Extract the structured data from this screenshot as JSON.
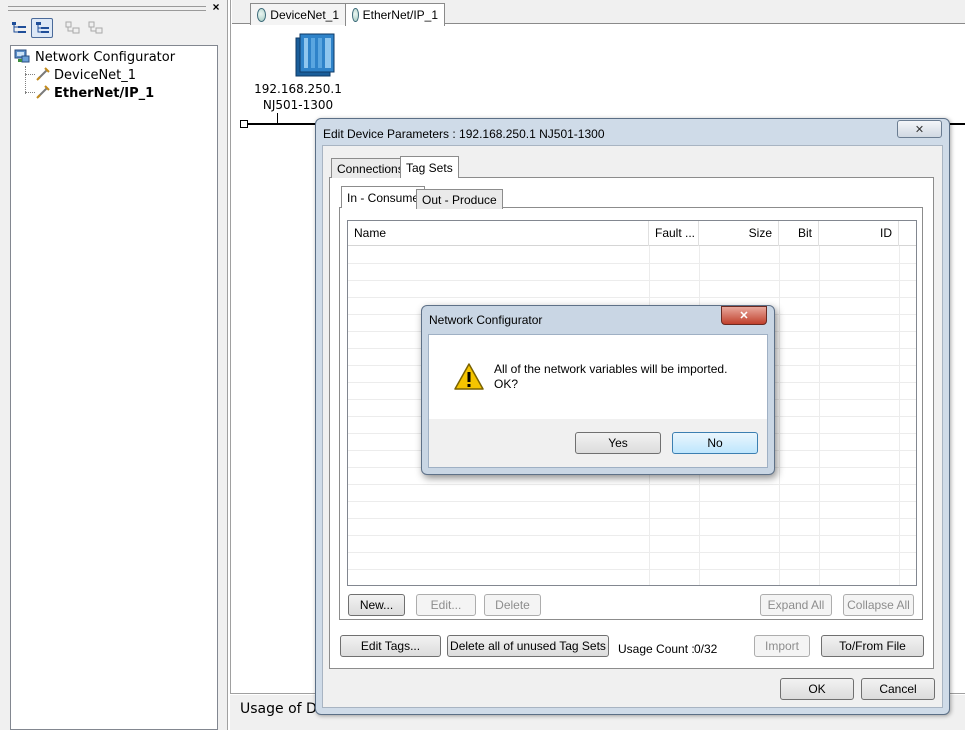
{
  "left_panel": {
    "tree": {
      "root": "Network Configurator",
      "children": [
        "DeviceNet_1",
        "EtherNet/IP_1"
      ]
    }
  },
  "main": {
    "tabs": [
      "DeviceNet_1",
      "EtherNet/IP_1"
    ],
    "device": {
      "ip": "192.168.250.1",
      "model": "NJ501-1300"
    },
    "bottom_panel_title": "Usage of De"
  },
  "edit_dialog": {
    "title": "Edit Device Parameters : 192.168.250.1 NJ501-1300",
    "close_glyph": "✕",
    "tabs": [
      "Connections",
      "Tag Sets"
    ],
    "subtabs": [
      "In - Consume",
      "Out - Produce"
    ],
    "columns": [
      "Name",
      "Fault ...",
      "Size",
      "Bit",
      "ID"
    ],
    "buttons": {
      "new": "New...",
      "edit": "Edit...",
      "delete": "Delete",
      "expand_all": "Expand All",
      "collapse_all": "Collapse All",
      "edit_tags": "Edit Tags...",
      "delete_unused": "Delete all of unused Tag Sets",
      "import": "Import",
      "to_from_file": "To/From File",
      "ok": "OK",
      "cancel": "Cancel"
    },
    "usage_label": "Usage Count :",
    "usage_value": "0/32"
  },
  "message_box": {
    "title": "Network Configurator",
    "close_glyph": "✕",
    "line1": "All of the network variables will be imported.",
    "line2": "OK?",
    "yes": "Yes",
    "no": "No"
  },
  "colors": {
    "dialog_frame": "#cfdbe8",
    "close_button_red": "#c0402c",
    "warning_yellow": "#f5c400"
  }
}
